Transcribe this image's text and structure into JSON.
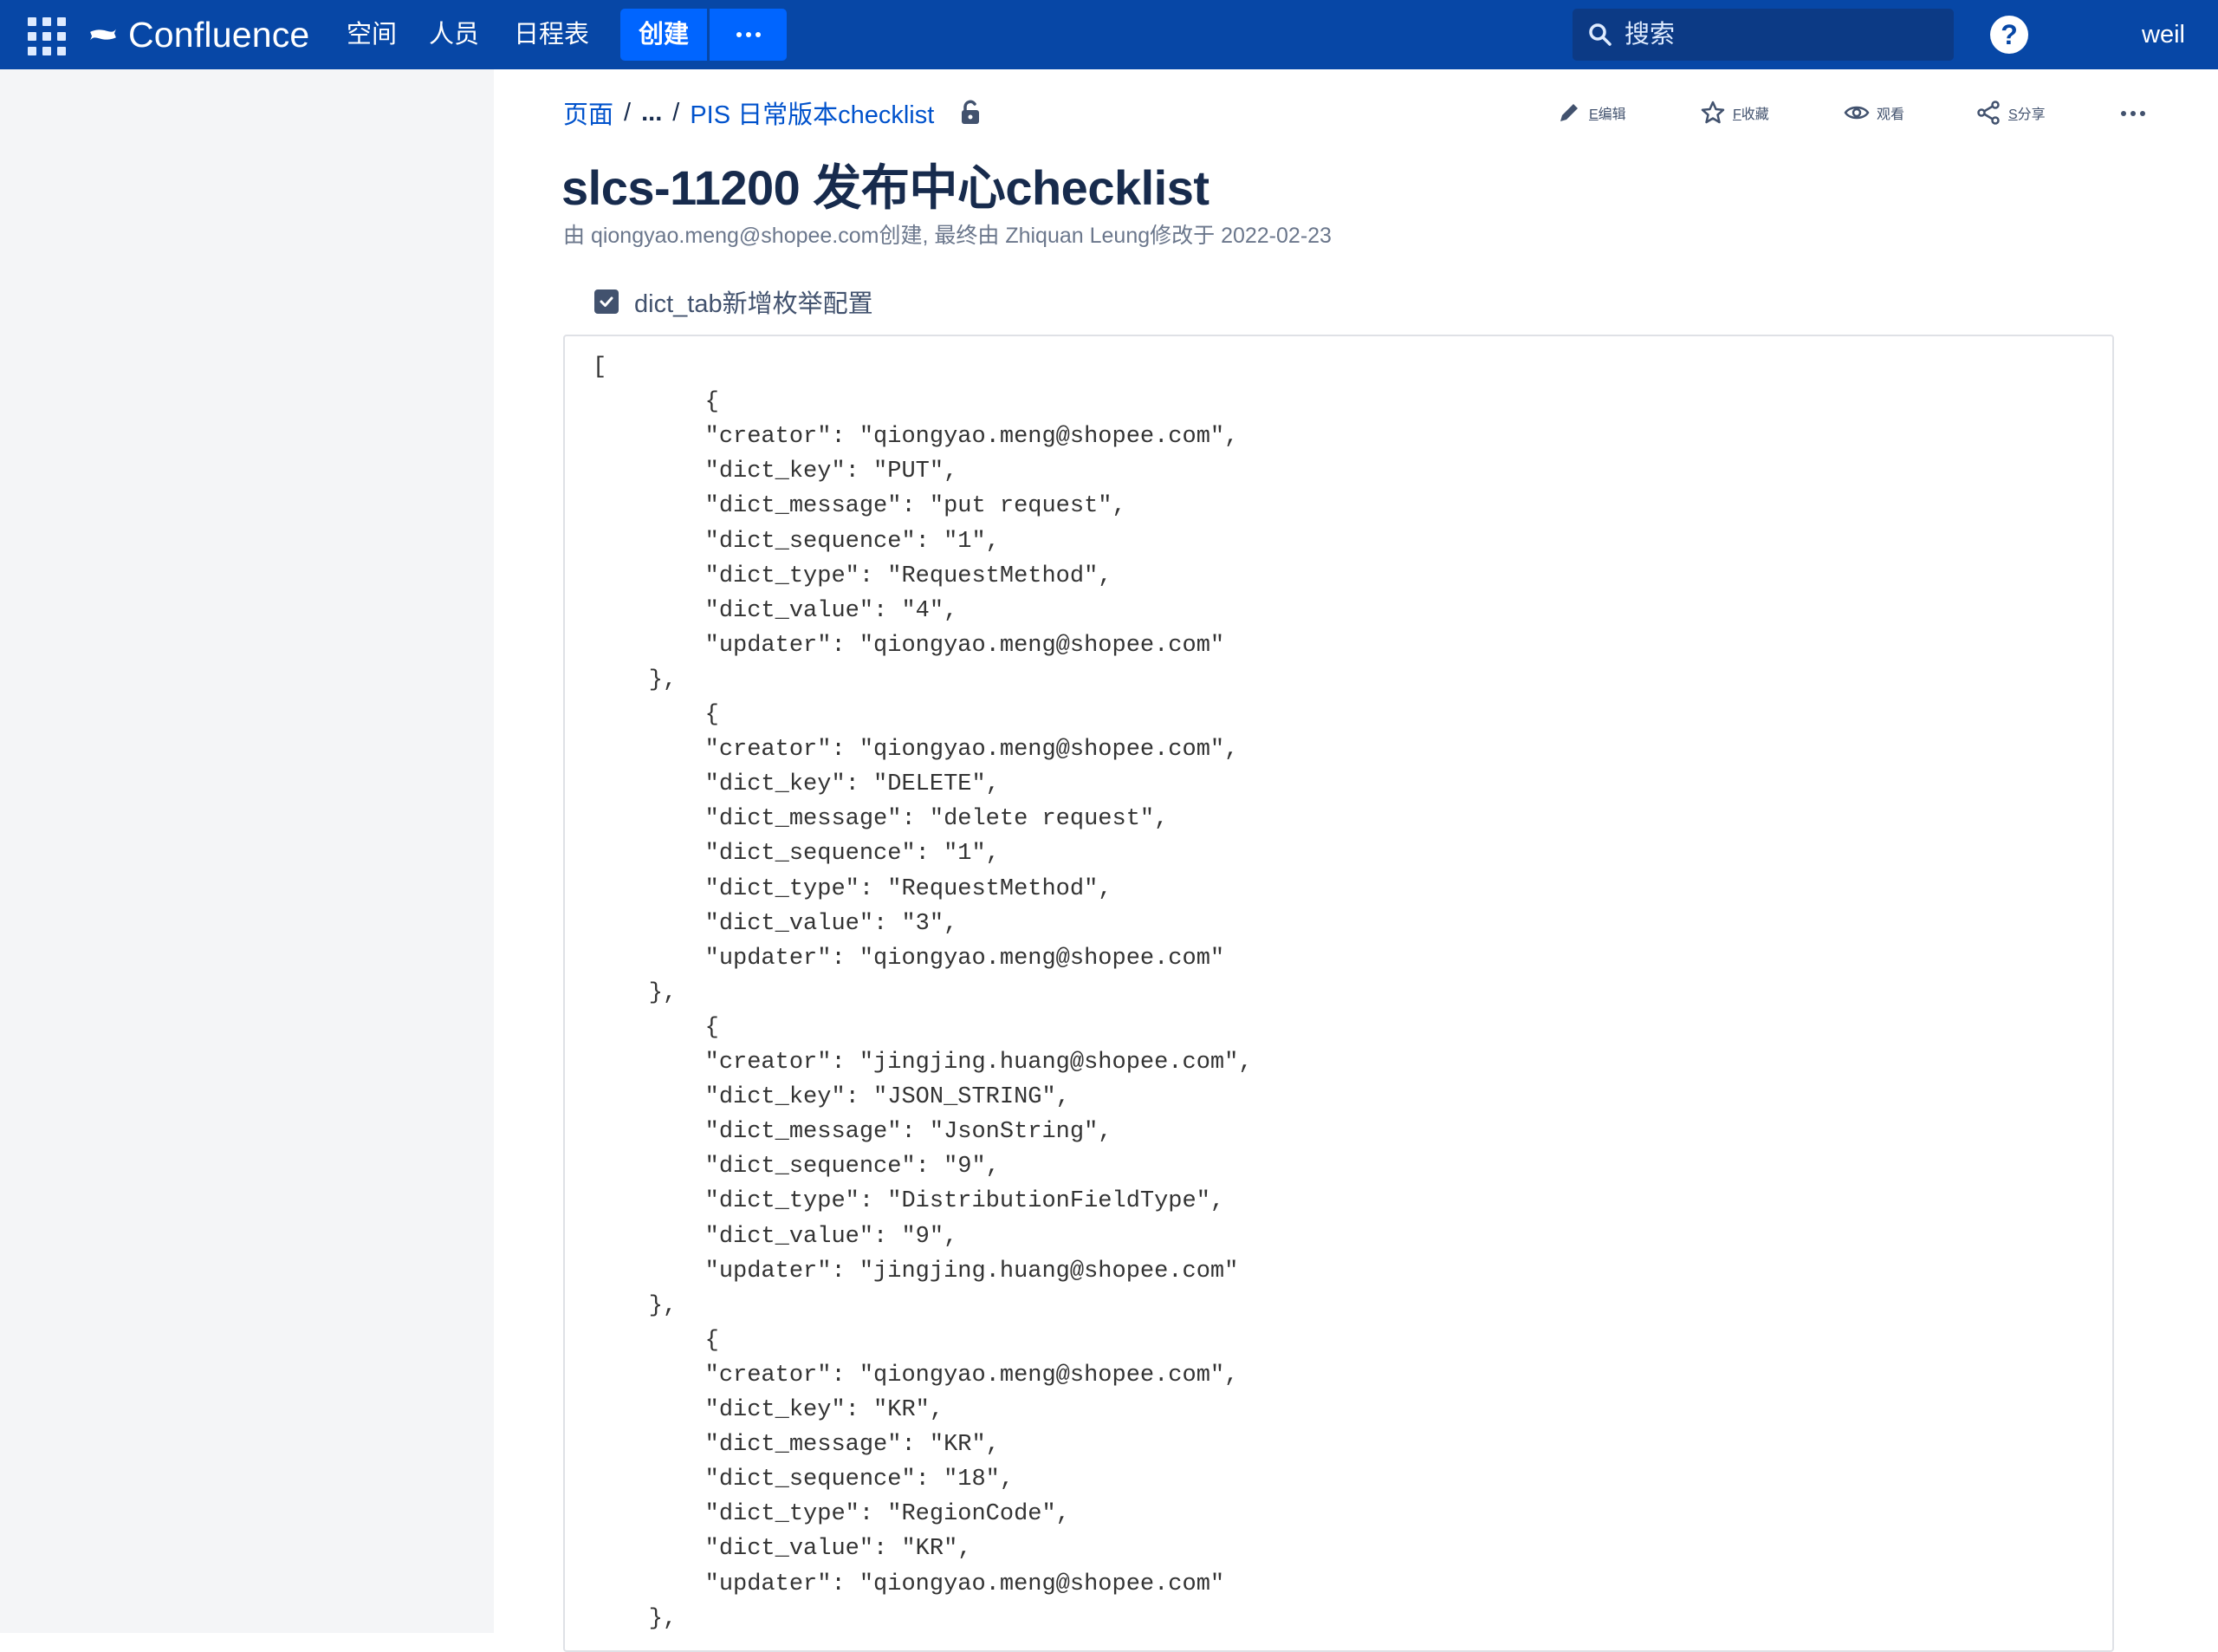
{
  "header": {
    "logo_text": "Confluence",
    "nav": [
      "空间",
      "人员",
      "日程表"
    ],
    "create_label": "创建",
    "search_placeholder": "搜索",
    "help_label": "?",
    "user_label": "weil"
  },
  "breadcrumb": {
    "items": [
      "页面",
      "...",
      "PIS 日常版本checklist"
    ],
    "separator": "/"
  },
  "page_actions": {
    "edit_key": "E",
    "edit_label": "编辑",
    "save_key": "F",
    "save_label": "收藏",
    "watch_label": "观看",
    "share_key": "S",
    "share_label": "分享"
  },
  "page": {
    "title": "slcs-11200 发布中心checklist",
    "byline": "由 qiongyao.meng@shopee.com创建, 最终由 Zhiquan Leung修改于 2022-02-23"
  },
  "task": {
    "checked": true,
    "label": "dict_tab新增枚举配置"
  },
  "code_lines": [
    "[",
    "        {",
    "        \"creator\": \"qiongyao.meng@shopee.com\",",
    "        \"dict_key\": \"PUT\",",
    "        \"dict_message\": \"put request\",",
    "        \"dict_sequence\": \"1\",",
    "        \"dict_type\": \"RequestMethod\",",
    "        \"dict_value\": \"4\",",
    "        \"updater\": \"qiongyao.meng@shopee.com\"",
    "    },",
    "        {",
    "        \"creator\": \"qiongyao.meng@shopee.com\",",
    "        \"dict_key\": \"DELETE\",",
    "        \"dict_message\": \"delete request\",",
    "        \"dict_sequence\": \"1\",",
    "        \"dict_type\": \"RequestMethod\",",
    "        \"dict_value\": \"3\",",
    "        \"updater\": \"qiongyao.meng@shopee.com\"",
    "    },",
    "        {",
    "        \"creator\": \"jingjing.huang@shopee.com\",",
    "        \"dict_key\": \"JSON_STRING\",",
    "        \"dict_message\": \"JsonString\",",
    "        \"dict_sequence\": \"9\",",
    "        \"dict_type\": \"DistributionFieldType\",",
    "        \"dict_value\": \"9\",",
    "        \"updater\": \"jingjing.huang@shopee.com\"",
    "    },",
    "        {",
    "        \"creator\": \"qiongyao.meng@shopee.com\",",
    "        \"dict_key\": \"KR\",",
    "        \"dict_message\": \"KR\",",
    "        \"dict_sequence\": \"18\",",
    "        \"dict_type\": \"RegionCode\",",
    "        \"dict_value\": \"KR\",",
    "        \"updater\": \"qiongyao.meng@shopee.com\"",
    "    },"
  ],
  "colors": {
    "header_bg": "#0747a6",
    "create_bg": "#0065ff",
    "link": "#0052cc",
    "sidebar_bg": "#f4f5f7"
  }
}
